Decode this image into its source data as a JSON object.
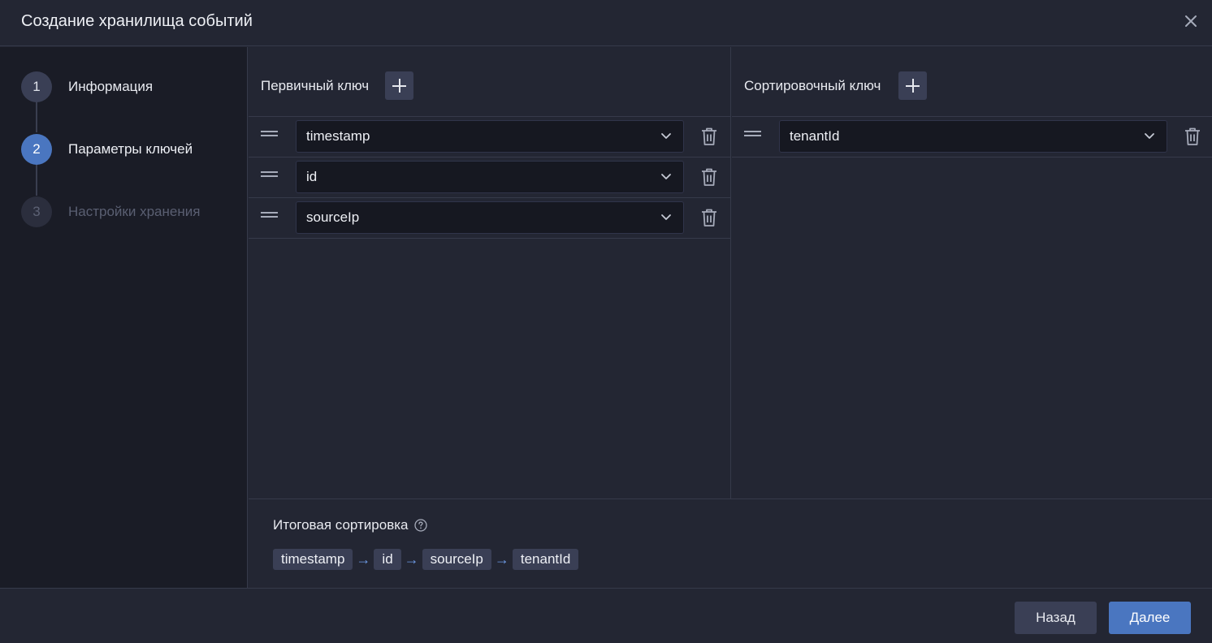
{
  "dialog": {
    "title": "Создание хранилища событий"
  },
  "steps": [
    {
      "number": "1",
      "label": "Информация",
      "state": "done"
    },
    {
      "number": "2",
      "label": "Параметры ключей",
      "state": "active"
    },
    {
      "number": "3",
      "label": "Настройки хранения",
      "state": "pending"
    }
  ],
  "primary_key": {
    "title": "Первичный ключ",
    "fields": [
      "timestamp",
      "id",
      "sourceIp"
    ]
  },
  "sort_key": {
    "title": "Сортировочный ключ",
    "fields": [
      "tenantId"
    ]
  },
  "summary": {
    "title": "Итоговая сортировка",
    "chain": [
      "timestamp",
      "id",
      "sourceIp",
      "tenantId"
    ],
    "separator": "→"
  },
  "footer": {
    "back_label": "Назад",
    "next_label": "Далее"
  },
  "colors": {
    "accent": "#4a76c0",
    "background": "#232633",
    "sidebar": "#1a1c26"
  }
}
